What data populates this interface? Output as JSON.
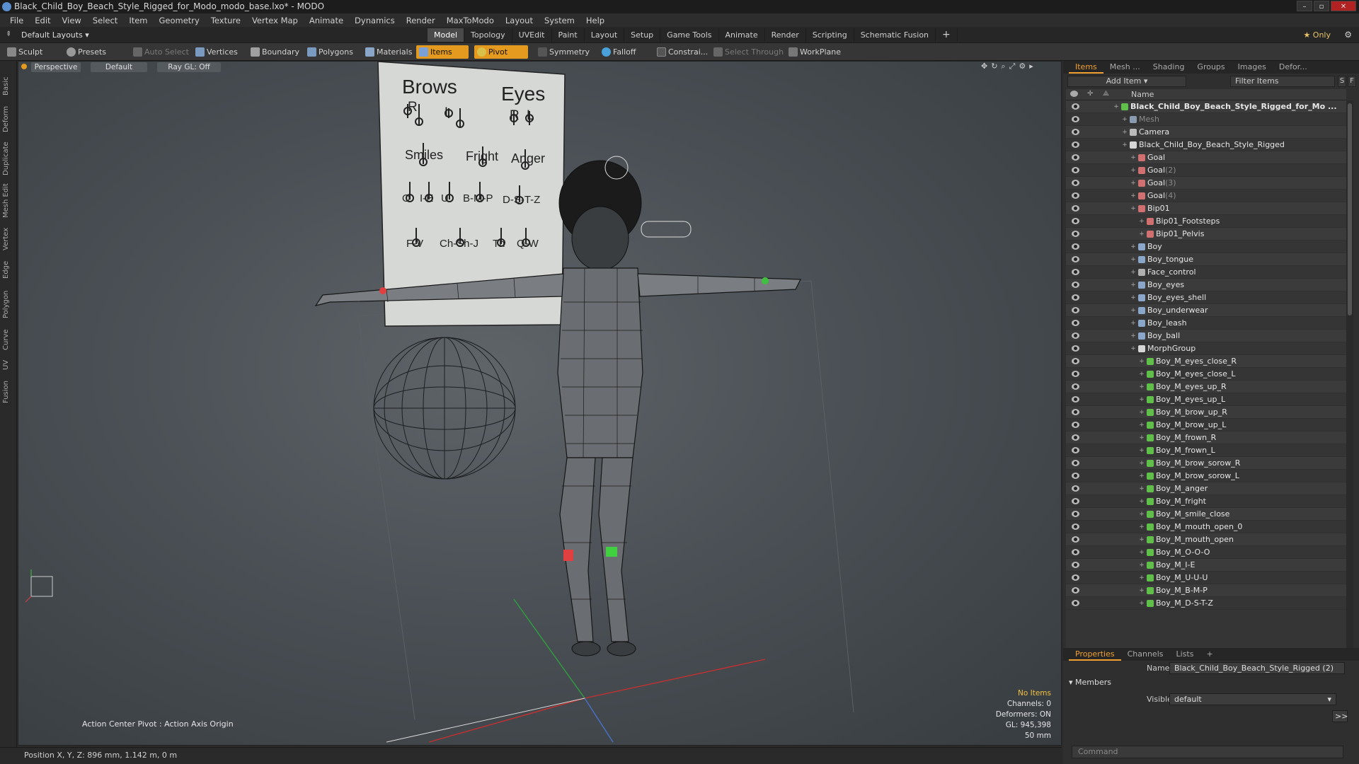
{
  "window": {
    "title": "Black_Child_Boy_Beach_Style_Rigged_for_Modo_modo_base.lxo* - MODO",
    "controls": [
      "–",
      "▫",
      "✕"
    ]
  },
  "menu": [
    "File",
    "Edit",
    "View",
    "Select",
    "Item",
    "Geometry",
    "Texture",
    "Vertex Map",
    "Animate",
    "Dynamics",
    "Render",
    "MaxToModo",
    "Layout",
    "System",
    "Help"
  ],
  "layout_row": {
    "layout_select": "Default Layouts ▾",
    "tabs": [
      "Model",
      "Topology",
      "UVEdit",
      "Paint",
      "Layout",
      "Setup",
      "Game Tools",
      "Animate",
      "Render",
      "Scripting",
      "Schematic Fusion"
    ],
    "active_tab": "Model",
    "add": "+",
    "only": "★ Only"
  },
  "toolbar": {
    "sculpt": "Sculpt",
    "presets": "Presets",
    "auto_select": "Auto Select",
    "vertices": "Vertices",
    "boundary": "Boundary",
    "polygons": "Polygons",
    "materials": "Materials",
    "items": "Items",
    "pivot": "Pivot",
    "symmetry": "Symmetry",
    "falloff": "Falloff",
    "constrain": "Constrai...",
    "select_through": "Select Through",
    "workplane": "WorkPlane"
  },
  "left_tabs": [
    "Basic",
    "Deform",
    "Duplicate",
    "Mesh Edit",
    "Vertex",
    "Edge",
    "Polygon",
    "Curve",
    "UV",
    "Fusion"
  ],
  "viewport": {
    "perspective": "Perspective",
    "default": "Default",
    "raygl": "Ray GL: Off",
    "action_center": "Action Center Pivot : Action Axis Origin",
    "hud": {
      "no_items": "No Items",
      "channels": "Channels: 0",
      "deformers": "Deformers: ON",
      "gl": "GL: 945,398",
      "focal": "50 mm"
    },
    "board": {
      "brows": "Brows",
      "eyes": "Eyes",
      "r1": "R",
      "l1": "L",
      "r2": "R",
      "l2": "L",
      "smiles": "Smiles",
      "fright": "Fright",
      "anger": "Anger",
      "o": "O",
      "ie": "I-E",
      "u": "U",
      "bmp": "B-M-P",
      "dstz": "D-S-T-Z",
      "fv": "F-V",
      "chshj": "Ch-Sh-J",
      "th": "Th",
      "qw": "Q-W"
    }
  },
  "status": {
    "position": "Position X, Y, Z:  896 mm, 1.142 m, 0 m"
  },
  "items_panel": {
    "tabs": [
      "Items",
      "Mesh ...",
      "Shading",
      "Groups",
      "Images",
      "Defor..."
    ],
    "active_tab": "Items",
    "add_item": "Add Item",
    "filter_placeholder": "Filter Items",
    "s_btn": "S",
    "f_btn": "F",
    "name_header": "Name",
    "rows": [
      {
        "label": "Black_Child_Boy_Beach_Style_Rigged_for_Mo ...",
        "suffix": "",
        "bold": true,
        "muted": false
      },
      {
        "label": "Mesh",
        "suffix": "",
        "bold": false,
        "muted": true
      },
      {
        "label": "Camera",
        "suffix": "",
        "bold": false,
        "muted": false
      },
      {
        "label": "Black_Child_Boy_Beach_Style_Rigged",
        "suffix": "",
        "bold": false,
        "muted": false
      },
      {
        "label": "Goal",
        "suffix": "",
        "bold": false,
        "muted": false
      },
      {
        "label": "Goal",
        "suffix": " (2)",
        "bold": false,
        "muted": false
      },
      {
        "label": "Goal",
        "suffix": " (3)",
        "bold": false,
        "muted": false
      },
      {
        "label": "Goal",
        "suffix": " (4)",
        "bold": false,
        "muted": false
      },
      {
        "label": "Bip01",
        "suffix": "",
        "bold": false,
        "muted": false
      },
      {
        "label": "Bip01_Footsteps",
        "suffix": "",
        "bold": false,
        "muted": false
      },
      {
        "label": "Bip01_Pelvis",
        "suffix": "",
        "bold": false,
        "muted": false
      },
      {
        "label": "Boy",
        "suffix": "",
        "bold": false,
        "muted": false
      },
      {
        "label": "Boy_tongue",
        "suffix": "",
        "bold": false,
        "muted": false
      },
      {
        "label": "Face_control",
        "suffix": "",
        "bold": false,
        "muted": false
      },
      {
        "label": "Boy_eyes",
        "suffix": "",
        "bold": false,
        "muted": false
      },
      {
        "label": "Boy_eyes_shell",
        "suffix": "",
        "bold": false,
        "muted": false
      },
      {
        "label": "Boy_underwear",
        "suffix": "",
        "bold": false,
        "muted": false
      },
      {
        "label": "Boy_leash",
        "suffix": "",
        "bold": false,
        "muted": false
      },
      {
        "label": "Boy_ball",
        "suffix": "",
        "bold": false,
        "muted": false
      },
      {
        "label": "MorphGroup",
        "suffix": "",
        "bold": false,
        "muted": false
      },
      {
        "label": "Boy_M_eyes_close_R",
        "suffix": "",
        "bold": false,
        "muted": false
      },
      {
        "label": "Boy_M_eyes_close_L",
        "suffix": "",
        "bold": false,
        "muted": false
      },
      {
        "label": "Boy_M_eyes_up_R",
        "suffix": "",
        "bold": false,
        "muted": false
      },
      {
        "label": "Boy_M_eyes_up_L",
        "suffix": "",
        "bold": false,
        "muted": false
      },
      {
        "label": "Boy_M_brow_up_R",
        "suffix": "",
        "bold": false,
        "muted": false
      },
      {
        "label": "Boy_M_brow_up_L",
        "suffix": "",
        "bold": false,
        "muted": false
      },
      {
        "label": "Boy_M_frown_R",
        "suffix": "",
        "bold": false,
        "muted": false
      },
      {
        "label": "Boy_M_frown_L",
        "suffix": "",
        "bold": false,
        "muted": false
      },
      {
        "label": "Boy_M_brow_sorow_R",
        "suffix": "",
        "bold": false,
        "muted": false
      },
      {
        "label": "Boy_M_brow_sorow_L",
        "suffix": "",
        "bold": false,
        "muted": false
      },
      {
        "label": "Boy_M_anger",
        "suffix": "",
        "bold": false,
        "muted": false
      },
      {
        "label": "Boy_M_fright",
        "suffix": "",
        "bold": false,
        "muted": false
      },
      {
        "label": "Boy_M_smile_close",
        "suffix": "",
        "bold": false,
        "muted": false
      },
      {
        "label": "Boy_M_mouth_open_0",
        "suffix": "",
        "bold": false,
        "muted": false
      },
      {
        "label": "Boy_M_mouth_open",
        "suffix": "",
        "bold": false,
        "muted": false
      },
      {
        "label": "Boy_M_O-O-O",
        "suffix": "",
        "bold": false,
        "muted": false
      },
      {
        "label": "Boy_M_I-E",
        "suffix": "",
        "bold": false,
        "muted": false
      },
      {
        "label": "Boy_M_U-U-U",
        "suffix": "",
        "bold": false,
        "muted": false
      },
      {
        "label": "Boy_M_B-M-P",
        "suffix": "",
        "bold": false,
        "muted": false
      },
      {
        "label": "Boy_M_D-S-T-Z",
        "suffix": "",
        "bold": false,
        "muted": false
      }
    ]
  },
  "properties": {
    "tabs": [
      "Properties",
      "Channels",
      "Lists",
      "+"
    ],
    "active_tab": "Properties",
    "name_label": "Name",
    "name_value": "Black_Child_Boy_Beach_Style_Rigged (2)",
    "members": "Members",
    "visible_label": "Visible",
    "visible_value": "default",
    "more": ">>",
    "command_placeholder": "Command"
  },
  "colors": {
    "accent": "#e39a1e",
    "morph_icon": "#5fbf4a",
    "locator_icon": "#d07070"
  }
}
